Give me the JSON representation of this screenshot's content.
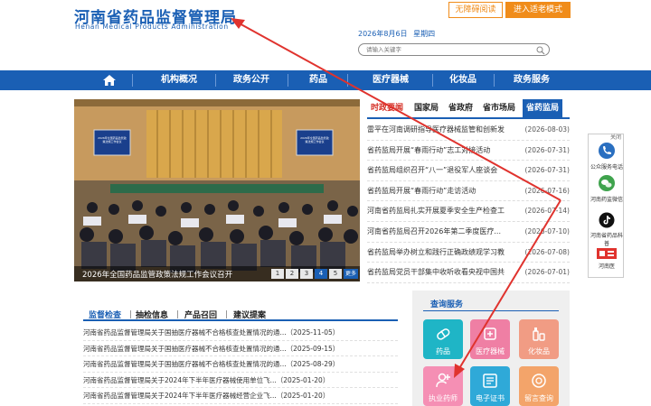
{
  "header": {
    "logo_cn": "河南省药品监督管理局",
    "logo_en": "Henan Medical Products Administration",
    "accessibility_label": "无障碍阅读",
    "elder_mode_label": "进入适老模式",
    "date": "2026年8月6日",
    "weekday": "星期四",
    "search_placeholder": "请输入关键字"
  },
  "nav": {
    "items": [
      "机构概况",
      "政务公开",
      "药品",
      "医疗器械",
      "化妆品",
      "政务服务"
    ]
  },
  "slider": {
    "caption": "2026年全国药品监管政策法规工作会议召开",
    "pages": [
      "1",
      "2",
      "3",
      "4",
      "5"
    ],
    "active_page": "4",
    "screen_text": "2026年全国药品监管政策法规工作会议",
    "more_label": "更多"
  },
  "news": {
    "tabs": [
      "时政要闻",
      "国家局",
      "省政府",
      "省市场局",
      "省药监局"
    ],
    "items": [
      {
        "title": "雷平在河南调研指导医疗器械监管和创新发...",
        "date": "(2026-08-03)"
      },
      {
        "title": "省药监局开展“春雨行动”志工对接活动",
        "date": "(2026-07-31)"
      },
      {
        "title": "省药监局组织召开“八一”退役军人座谈会",
        "date": "(2026-07-31)"
      },
      {
        "title": "省药监局开展“春雨行动”走访活动",
        "date": "(2026-07-16)"
      },
      {
        "title": "河南省药监局扎实开展夏季安全生产检查工...",
        "date": "(2026-07-14)"
      },
      {
        "title": "河南省药监局召开2026年第二季度医疗...",
        "date": "(2026-07-10)"
      },
      {
        "title": "省药监局举办树立和践行正确政绩观学习教...",
        "date": "(2026-07-08)"
      },
      {
        "title": "省药监局党员干部集中收听收看央视中国共...",
        "date": "(2026-07-01)"
      }
    ]
  },
  "sidebar": {
    "close_label": "关闭",
    "items": [
      "公众服务电话",
      "河南药监微信",
      "河南省药品科普",
      "河南医"
    ]
  },
  "check": {
    "tabs": [
      "监督检查",
      "抽检信息",
      "产品召回",
      "建议提案"
    ],
    "items": [
      "河南省药品监督管理局关于国抽医疗器械不合格核查处置情况的通...（2025-11-05）",
      "河南省药品监督管理局关于国抽医疗器械不合格核查处置情况的通...（2025-09-15）",
      "河南省药品监督管理局关于国抽医疗器械不合格核查处置情况的通...（2025-08-29）",
      "河南省药品监督管理局关于2024年下半年医疗器械使用单位飞...（2025-01-20）",
      "河南省药品监督管理局关于2024年下半年医疗器械经营企业飞...（2025-01-20）"
    ]
  },
  "query": {
    "title": "查询服务",
    "buttons": [
      {
        "label": "药品",
        "color": "#1fb5c6"
      },
      {
        "label": "医疗器械",
        "color": "#ef7fa4"
      },
      {
        "label": "化妆品",
        "color": "#f19c84"
      },
      {
        "label": "执业药师",
        "color": "#f58fb4"
      },
      {
        "label": "电子证书",
        "color": "#2fa9d8"
      },
      {
        "label": "留言查询",
        "color": "#f3a46a"
      }
    ]
  },
  "colors": {
    "brand_blue": "#1a5fb4",
    "accent_orange": "#f08c1a",
    "annotation_red": "#e0332e"
  }
}
